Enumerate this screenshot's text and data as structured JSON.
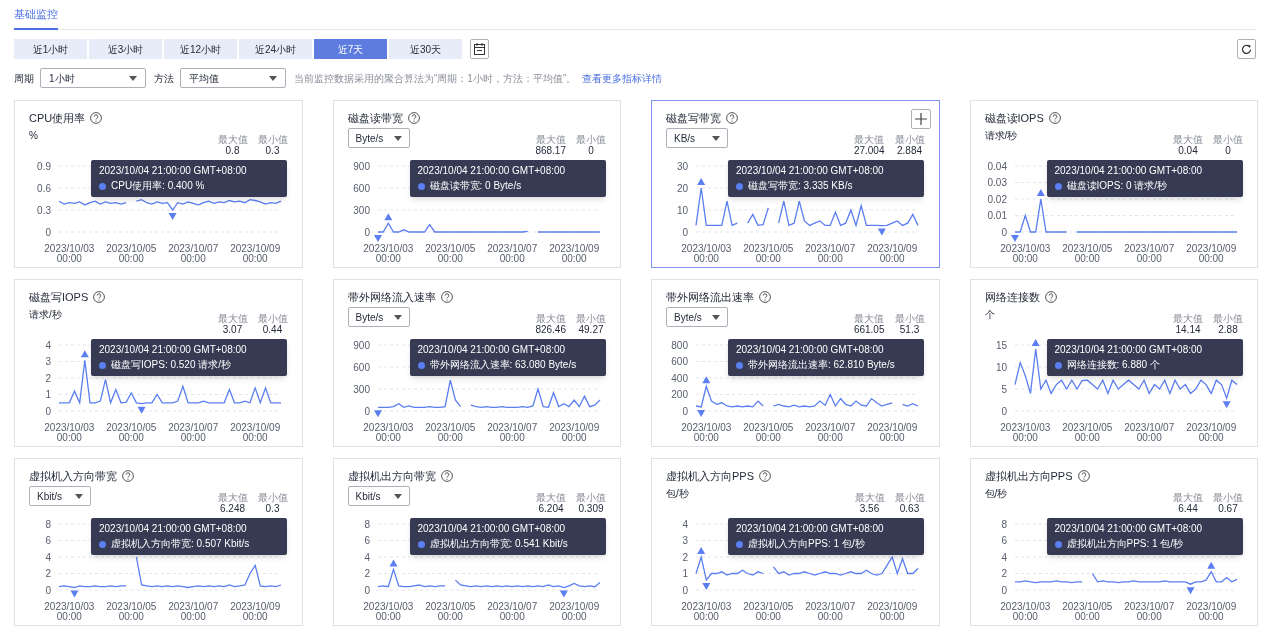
{
  "tabs": [
    {
      "label": "基础监控",
      "selected": true
    }
  ],
  "time_ranges": [
    {
      "label": "近1小时",
      "selected": false
    },
    {
      "label": "近3小时",
      "selected": false
    },
    {
      "label": "近12小时",
      "selected": false
    },
    {
      "label": "近24小时",
      "selected": false
    },
    {
      "label": "近7天",
      "selected": true
    },
    {
      "label": "近30天",
      "selected": false
    }
  ],
  "filters": {
    "period_label": "周期",
    "period": "1小时",
    "method_label": "方法",
    "method": "平均值",
    "note": "当前监控数据采用的聚合算法为“周期：1小时，方法：平均值”。",
    "link": "查看更多指标详情"
  },
  "cards": [
    {
      "title": "CPU使用率",
      "selected": false,
      "unit": {
        "kind": "label",
        "text": "%"
      },
      "stats": [
        {
          "label": "最大值",
          "value": "0.8"
        },
        {
          "label": "最小值",
          "value": "0.3"
        }
      ],
      "tooltip": {
        "time": "2023/10/04 21:00:00 GMT+08:00",
        "text": "CPU使用率: 0.400 %"
      },
      "chart_data": {
        "type": "line",
        "grid": true,
        "ylim": [
          0,
          0.9
        ],
        "yticks": [
          {
            "value": 0,
            "label": "0"
          },
          {
            "value": 0.3,
            "label": "0.3"
          },
          {
            "value": 0.6,
            "label": "0.6"
          },
          {
            "value": 0.9,
            "label": "0.9"
          }
        ],
        "categories": [
          null,
          null,
          "2023/10/03 00:00",
          null,
          null,
          null,
          null,
          null,
          null,
          null,
          null,
          null,
          null,
          null,
          "2023/10/05 00:00",
          null,
          null,
          null,
          null,
          null,
          null,
          null,
          null,
          null,
          null,
          null,
          "2023/10/07 00:00",
          null,
          null,
          null,
          null,
          null,
          null,
          null,
          null,
          null,
          null,
          null,
          "2023/10/09 00:00",
          null,
          null,
          null,
          null,
          null
        ],
        "series": [
          {
            "color": "#5b7ef0",
            "values": [
              0.42,
              0.38,
              0.4,
              0.39,
              0.41,
              0.37,
              0.4,
              0.42,
              0.38,
              0.41,
              0.39,
              0.4,
              0.38,
              0.4,
              null,
              0.42,
              0.44,
              0.4,
              0.38,
              0.41,
              0.39,
              0.4,
              0.3,
              0.4,
              0.38,
              0.41,
              0.39,
              0.37,
              0.4,
              0.42,
              0.39,
              0.41,
              0.4,
              0.43,
              0.41,
              0.42,
              0.4,
              0.44,
              0.43,
              0.41,
              0.38,
              0.4,
              0.39,
              0.42
            ]
          }
        ]
      }
    },
    {
      "title": "磁盘读带宽",
      "selected": false,
      "unit": {
        "kind": "dropdown",
        "text": "Byte/s"
      },
      "stats": [
        {
          "label": "最大值",
          "value": "868.17"
        },
        {
          "label": "最小值",
          "value": "0"
        }
      ],
      "tooltip": {
        "time": "2023/10/04 21:00:00 GMT+08:00",
        "text": "磁盘读带宽: 0 Byte/s"
      },
      "chart_data": {
        "type": "line",
        "grid": true,
        "ylim": [
          0,
          900
        ],
        "yticks": [
          {
            "value": 0,
            "label": "0"
          },
          {
            "value": 300,
            "label": "300"
          },
          {
            "value": 600,
            "label": "600"
          },
          {
            "value": 900,
            "label": "900"
          }
        ],
        "categories": [
          null,
          null,
          "2023/10/03 00:00",
          null,
          null,
          null,
          null,
          null,
          null,
          null,
          null,
          null,
          null,
          null,
          "2023/10/05 00:00",
          null,
          null,
          null,
          null,
          null,
          null,
          null,
          null,
          null,
          null,
          null,
          "2023/10/07 00:00",
          null,
          null,
          null,
          null,
          null,
          null,
          null,
          null,
          null,
          null,
          null,
          "2023/10/09 00:00",
          null,
          null,
          null,
          null,
          null
        ],
        "series": [
          {
            "color": "#5b7ef0",
            "values": [
              0,
              0,
              120,
              0,
              0,
              30,
              0,
              0,
              0,
              0,
              100,
              0,
              0,
              0,
              0,
              0,
              0,
              0,
              0,
              0,
              0,
              0,
              0,
              0,
              0,
              0,
              0,
              0,
              0,
              10,
              null,
              0,
              0,
              0,
              0,
              0,
              0,
              0,
              0,
              0,
              0,
              0,
              0,
              0
            ]
          }
        ]
      }
    },
    {
      "title": "磁盘写带宽",
      "selected": true,
      "unit": {
        "kind": "dropdown",
        "text": "KB/s"
      },
      "stats": [
        {
          "label": "最大值",
          "value": "27.004"
        },
        {
          "label": "最小值",
          "value": "2.884"
        }
      ],
      "tooltip": {
        "time": "2023/10/04 21:00:00 GMT+08:00",
        "text": "磁盘写带宽: 3.335 KB/s"
      },
      "chart_data": {
        "type": "line",
        "grid": true,
        "ylim": [
          0,
          30
        ],
        "yticks": [
          {
            "value": 0,
            "label": "0"
          },
          {
            "value": 10,
            "label": "10"
          },
          {
            "value": 20,
            "label": "20"
          },
          {
            "value": 30,
            "label": "30"
          }
        ],
        "categories": [
          null,
          null,
          "2023/10/03 00:00",
          null,
          null,
          null,
          null,
          null,
          null,
          null,
          null,
          null,
          null,
          null,
          "2023/10/05 00:00",
          null,
          null,
          null,
          null,
          null,
          null,
          null,
          null,
          null,
          null,
          null,
          "2023/10/07 00:00",
          null,
          null,
          null,
          null,
          null,
          null,
          null,
          null,
          null,
          null,
          null,
          "2023/10/09 00:00",
          null,
          null,
          null,
          null,
          null
        ],
        "series": [
          {
            "color": "#5b7ef0",
            "values": [
              3,
              20,
              3,
              3,
              3,
              3,
              14,
              3,
              4,
              null,
              4,
              8,
              3,
              3.3,
              11,
              null,
              4,
              14,
              3,
              4,
              14,
              5,
              3,
              4,
              5,
              3,
              3,
              9,
              3,
              4,
              10,
              3,
              12,
              3,
              3,
              3,
              2.9,
              3,
              4,
              5,
              3,
              4,
              8,
              3
            ]
          }
        ]
      }
    },
    {
      "title": "磁盘读IOPS",
      "selected": false,
      "unit": {
        "kind": "label",
        "text": "请求/秒"
      },
      "stats": [
        {
          "label": "最大值",
          "value": "0.04"
        },
        {
          "label": "最小值",
          "value": "0"
        }
      ],
      "tooltip": {
        "time": "2023/10/04 21:00:00 GMT+08:00",
        "text": "磁盘读IOPS: 0 请求/秒"
      },
      "chart_data": {
        "type": "line",
        "grid": true,
        "ylim": [
          0,
          0.04
        ],
        "yticks": [
          {
            "value": 0,
            "label": "0"
          },
          {
            "value": 0.01,
            "label": "0.01"
          },
          {
            "value": 0.02,
            "label": "0.02"
          },
          {
            "value": 0.03,
            "label": "0.03"
          },
          {
            "value": 0.04,
            "label": "0.04"
          }
        ],
        "categories": [
          null,
          null,
          "2023/10/03 00:00",
          null,
          null,
          null,
          null,
          null,
          null,
          null,
          null,
          null,
          null,
          null,
          "2023/10/05 00:00",
          null,
          null,
          null,
          null,
          null,
          null,
          null,
          null,
          null,
          null,
          null,
          "2023/10/07 00:00",
          null,
          null,
          null,
          null,
          null,
          null,
          null,
          null,
          null,
          null,
          null,
          "2023/10/09 00:00",
          null,
          null,
          null,
          null,
          null
        ],
        "series": [
          {
            "color": "#5b7ef0",
            "values": [
              0,
              0,
              0.01,
              0,
              0,
              0.02,
              0,
              0,
              0,
              0,
              0,
              null,
              0,
              0,
              0,
              0,
              0,
              0,
              0,
              0,
              0,
              0,
              0,
              0,
              0,
              0,
              0,
              0,
              0,
              0,
              0,
              0,
              0,
              0,
              0,
              0,
              0,
              0,
              0,
              0,
              0,
              0,
              0,
              0
            ]
          }
        ]
      }
    },
    {
      "title": "磁盘写IOPS",
      "selected": false,
      "unit": {
        "kind": "label",
        "text": "请求/秒"
      },
      "stats": [
        {
          "label": "最大值",
          "value": "3.07"
        },
        {
          "label": "最小值",
          "value": "0.44"
        }
      ],
      "tooltip": {
        "time": "2023/10/04 21:00:00 GMT+08:00",
        "text": "磁盘写IOPS: 0.520 请求/秒"
      },
      "chart_data": {
        "type": "line",
        "grid": true,
        "ylim": [
          0,
          4
        ],
        "yticks": [
          {
            "value": 0,
            "label": "0"
          },
          {
            "value": 1,
            "label": "1"
          },
          {
            "value": 2,
            "label": "2"
          },
          {
            "value": 3,
            "label": "3"
          },
          {
            "value": 4,
            "label": "4"
          }
        ],
        "categories": [
          null,
          null,
          "2023/10/03 00:00",
          null,
          null,
          null,
          null,
          null,
          null,
          null,
          null,
          null,
          null,
          null,
          "2023/10/05 00:00",
          null,
          null,
          null,
          null,
          null,
          null,
          null,
          null,
          null,
          null,
          null,
          "2023/10/07 00:00",
          null,
          null,
          null,
          null,
          null,
          null,
          null,
          null,
          null,
          null,
          null,
          "2023/10/09 00:00",
          null,
          null,
          null,
          null,
          null
        ],
        "series": [
          {
            "color": "#5b7ef0",
            "values": [
              0.5,
              0.5,
              0.5,
              1.2,
              0.5,
              3.07,
              0.5,
              0.5,
              0.6,
              1.9,
              0.5,
              1.3,
              0.5,
              0.52,
              1.1,
              0.5,
              0.44,
              0.5,
              0.5,
              1.0,
              0.5,
              0.5,
              0.5,
              0.6,
              1.5,
              0.5,
              0.5,
              0.5,
              0.6,
              0.5,
              0.5,
              0.5,
              0.5,
              1.3,
              0.5,
              0.5,
              0.6,
              0.5,
              1.4,
              0.5,
              1.4,
              0.5,
              0.5,
              0.5
            ]
          }
        ]
      }
    },
    {
      "title": "带外网络流入速率",
      "selected": false,
      "unit": {
        "kind": "dropdown",
        "text": "Byte/s"
      },
      "stats": [
        {
          "label": "最大值",
          "value": "826.46"
        },
        {
          "label": "最小值",
          "value": "49.27"
        }
      ],
      "tooltip": {
        "time": "2023/10/04 21:00:00 GMT+08:00",
        "text": "带外网络流入速率: 63.080 Byte/s"
      },
      "chart_data": {
        "type": "line",
        "grid": true,
        "ylim": [
          0,
          900
        ],
        "yticks": [
          {
            "value": 0,
            "label": "0"
          },
          {
            "value": 300,
            "label": "300"
          },
          {
            "value": 600,
            "label": "600"
          },
          {
            "value": 900,
            "label": "900"
          }
        ],
        "categories": [
          null,
          null,
          "2023/10/03 00:00",
          null,
          null,
          null,
          null,
          null,
          null,
          null,
          null,
          null,
          null,
          null,
          "2023/10/05 00:00",
          null,
          null,
          null,
          null,
          null,
          null,
          null,
          null,
          null,
          null,
          null,
          "2023/10/07 00:00",
          null,
          null,
          null,
          null,
          null,
          null,
          null,
          null,
          null,
          null,
          null,
          "2023/10/09 00:00",
          null,
          null,
          null,
          null,
          null
        ],
        "series": [
          {
            "color": "#5b7ef0",
            "values": [
              50,
              50,
              50,
              60,
              100,
              50,
              70,
              50,
              50,
              50,
              60,
              50,
              50,
              60,
              420,
              150,
              60,
              null,
              80,
              60,
              50,
              60,
              50,
              50,
              60,
              50,
              50,
              50,
              60,
              50,
              70,
              300,
              60,
              50,
              250,
              60,
              100,
              60,
              150,
              60,
              200,
              60,
              80,
              150
            ]
          }
        ]
      }
    },
    {
      "title": "带外网络流出速率",
      "selected": false,
      "unit": {
        "kind": "dropdown",
        "text": "Byte/s"
      },
      "stats": [
        {
          "label": "最大值",
          "value": "661.05"
        },
        {
          "label": "最小值",
          "value": "51.3"
        }
      ],
      "tooltip": {
        "time": "2023/10/04 21:00:00 GMT+08:00",
        "text": "带外网络流出速率: 62.810 Byte/s"
      },
      "chart_data": {
        "type": "line",
        "grid": true,
        "ylim": [
          0,
          800
        ],
        "yticks": [
          {
            "value": 0,
            "label": "0"
          },
          {
            "value": 200,
            "label": "200"
          },
          {
            "value": 400,
            "label": "400"
          },
          {
            "value": 600,
            "label": "600"
          },
          {
            "value": 800,
            "label": "800"
          }
        ],
        "categories": [
          null,
          null,
          "2023/10/03 00:00",
          null,
          null,
          null,
          null,
          null,
          null,
          null,
          null,
          null,
          null,
          null,
          "2023/10/05 00:00",
          null,
          null,
          null,
          null,
          null,
          null,
          null,
          null,
          null,
          null,
          null,
          "2023/10/07 00:00",
          null,
          null,
          null,
          null,
          null,
          null,
          null,
          null,
          null,
          null,
          null,
          "2023/10/09 00:00",
          null,
          null,
          null,
          null,
          null
        ],
        "series": [
          {
            "color": "#5b7ef0",
            "values": [
              60,
              50,
              300,
              120,
              80,
              100,
              60,
              50,
              60,
              50,
              60,
              50,
              120,
              60,
              null,
              60,
              80,
              60,
              50,
              70,
              50,
              60,
              50,
              60,
              120,
              70,
              200,
              60,
              150,
              80,
              60,
              120,
              70,
              60,
              150,
              100,
              60,
              80,
              100,
              null,
              80,
              60,
              90,
              60
            ]
          }
        ]
      }
    },
    {
      "title": "网络连接数",
      "selected": false,
      "unit": {
        "kind": "label",
        "text": "个"
      },
      "stats": [
        {
          "label": "最大值",
          "value": "14.14"
        },
        {
          "label": "最小值",
          "value": "2.88"
        }
      ],
      "tooltip": {
        "time": "2023/10/04 21:00:00 GMT+08:00",
        "text": "网络连接数: 6.880 个"
      },
      "chart_data": {
        "type": "line",
        "grid": true,
        "ylim": [
          0,
          15
        ],
        "yticks": [
          {
            "value": 0,
            "label": "0"
          },
          {
            "value": 5,
            "label": "5"
          },
          {
            "value": 10,
            "label": "10"
          },
          {
            "value": 15,
            "label": "15"
          }
        ],
        "categories": [
          null,
          null,
          "2023/10/03 00:00",
          null,
          null,
          null,
          null,
          null,
          null,
          null,
          null,
          null,
          null,
          null,
          "2023/10/05 00:00",
          null,
          null,
          null,
          null,
          null,
          null,
          null,
          null,
          null,
          null,
          null,
          "2023/10/07 00:00",
          null,
          null,
          null,
          null,
          null,
          null,
          null,
          null,
          null,
          null,
          null,
          "2023/10/09 00:00",
          null,
          null,
          null,
          null,
          null
        ],
        "series": [
          {
            "color": "#5b7ef0",
            "values": [
              6,
              11,
              8,
              4,
              14.1,
              5,
              7,
              4,
              6,
              7,
              5,
              7,
              5,
              6.9,
              7,
              6,
              5,
              7,
              4,
              7,
              5,
              6,
              7,
              6,
              5,
              7,
              4,
              6,
              5,
              7,
              4,
              7,
              5,
              6,
              4,
              5,
              7,
              6,
              4,
              7,
              6,
              2.9,
              7,
              6
            ]
          }
        ]
      }
    },
    {
      "title": "虚拟机入方向带宽",
      "selected": false,
      "unit": {
        "kind": "dropdown",
        "text": "Kbit/s"
      },
      "stats": [
        {
          "label": "最大值",
          "value": "6.248"
        },
        {
          "label": "最小值",
          "value": "0.3"
        }
      ],
      "tooltip": {
        "time": "2023/10/04 21:00:00 GMT+08:00",
        "text": "虚拟机入方向带宽: 0.507 Kbit/s"
      },
      "chart_data": {
        "type": "line",
        "grid": true,
        "ylim": [
          0,
          8
        ],
        "yticks": [
          {
            "value": 0,
            "label": "0"
          },
          {
            "value": 2,
            "label": "2"
          },
          {
            "value": 4,
            "label": "4"
          },
          {
            "value": 6,
            "label": "6"
          },
          {
            "value": 8,
            "label": "8"
          }
        ],
        "categories": [
          null,
          null,
          "2023/10/03 00:00",
          null,
          null,
          null,
          null,
          null,
          null,
          null,
          null,
          null,
          null,
          null,
          "2023/10/05 00:00",
          null,
          null,
          null,
          null,
          null,
          null,
          null,
          null,
          null,
          null,
          null,
          "2023/10/07 00:00",
          null,
          null,
          null,
          null,
          null,
          null,
          null,
          null,
          null,
          null,
          null,
          "2023/10/09 00:00",
          null,
          null,
          null,
          null,
          null
        ],
        "series": [
          {
            "color": "#5b7ef0",
            "values": [
              0.4,
              0.5,
              0.4,
              0.3,
              0.5,
              0.4,
              0.4,
              0.5,
              0.4,
              0.4,
              0.5,
              0.4,
              0.5,
              0.5,
              null,
              4.0,
              0.6,
              0.5,
              0.4,
              0.5,
              0.4,
              0.5,
              0.4,
              0.5,
              0.4,
              0.3,
              0.4,
              0.5,
              0.4,
              0.5,
              0.4,
              0.5,
              0.4,
              0.6,
              0.4,
              0.5,
              0.6,
              2.0,
              3.0,
              0.5,
              0.4,
              0.5,
              0.4,
              0.6
            ]
          }
        ]
      }
    },
    {
      "title": "虚拟机出方向带宽",
      "selected": false,
      "unit": {
        "kind": "dropdown",
        "text": "Kbit/s"
      },
      "stats": [
        {
          "label": "最大值",
          "value": "6.204"
        },
        {
          "label": "最小值",
          "value": "0.309"
        }
      ],
      "tooltip": {
        "time": "2023/10/04 21:00:00 GMT+08:00",
        "text": "虚拟机出方向带宽: 0.541 Kbit/s"
      },
      "chart_data": {
        "type": "line",
        "grid": true,
        "ylim": [
          0,
          8
        ],
        "yticks": [
          {
            "value": 0,
            "label": "0"
          },
          {
            "value": 2,
            "label": "2"
          },
          {
            "value": 4,
            "label": "4"
          },
          {
            "value": 6,
            "label": "6"
          },
          {
            "value": 8,
            "label": "8"
          }
        ],
        "categories": [
          null,
          null,
          "2023/10/03 00:00",
          null,
          null,
          null,
          null,
          null,
          null,
          null,
          null,
          null,
          null,
          null,
          "2023/10/05 00:00",
          null,
          null,
          null,
          null,
          null,
          null,
          null,
          null,
          null,
          null,
          null,
          "2023/10/07 00:00",
          null,
          null,
          null,
          null,
          null,
          null,
          null,
          null,
          null,
          null,
          null,
          "2023/10/09 00:00",
          null,
          null,
          null,
          null,
          null
        ],
        "series": [
          {
            "color": "#5b7ef0",
            "values": [
              0.4,
              0.5,
              0.4,
              2.5,
              0.5,
              0.4,
              0.4,
              0.5,
              0.6,
              0.4,
              0.5,
              0.4,
              0.5,
              0.5,
              null,
              1.2,
              0.6,
              0.5,
              0.4,
              0.5,
              0.4,
              0.5,
              0.4,
              0.5,
              0.4,
              0.5,
              0.4,
              0.5,
              0.4,
              0.5,
              0.4,
              0.5,
              0.4,
              0.6,
              0.4,
              0.5,
              0.3,
              0.5,
              0.8,
              0.5,
              0.4,
              0.5,
              0.4,
              0.9
            ]
          }
        ]
      }
    },
    {
      "title": "虚拟机入方向PPS",
      "selected": false,
      "unit": {
        "kind": "label",
        "text": "包/秒"
      },
      "stats": [
        {
          "label": "最大值",
          "value": "3.56"
        },
        {
          "label": "最小值",
          "value": "0.63"
        }
      ],
      "tooltip": {
        "time": "2023/10/04 21:00:00 GMT+08:00",
        "text": "虚拟机入方向PPS: 1 包/秒"
      },
      "chart_data": {
        "type": "line",
        "grid": true,
        "ylim": [
          0,
          4
        ],
        "yticks": [
          {
            "value": 0,
            "label": "0"
          },
          {
            "value": 1,
            "label": "1"
          },
          {
            "value": 2,
            "label": "2"
          },
          {
            "value": 3,
            "label": "3"
          },
          {
            "value": 4,
            "label": "4"
          }
        ],
        "categories": [
          null,
          null,
          "2023/10/03 00:00",
          null,
          null,
          null,
          null,
          null,
          null,
          null,
          null,
          null,
          null,
          null,
          "2023/10/05 00:00",
          null,
          null,
          null,
          null,
          null,
          null,
          null,
          null,
          null,
          null,
          null,
          "2023/10/07 00:00",
          null,
          null,
          null,
          null,
          null,
          null,
          null,
          null,
          null,
          null,
          null,
          "2023/10/09 00:00",
          null,
          null,
          null,
          null,
          null
        ],
        "series": [
          {
            "color": "#5b7ef0",
            "values": [
              1,
              2,
              0.6,
              1,
              1,
              1.1,
              0.9,
              1,
              1,
              1.2,
              1,
              0.9,
              1.1,
              1,
              null,
              1.4,
              1,
              1.1,
              0.9,
              1,
              1,
              1.1,
              1,
              0.9,
              1,
              1.1,
              1,
              1,
              0.9,
              1,
              1.1,
              1,
              1,
              1.2,
              1,
              0.9,
              1,
              1.5,
              2,
              1,
              1.9,
              1,
              1,
              1.3
            ]
          }
        ]
      }
    },
    {
      "title": "虚拟机出方向PPS",
      "selected": false,
      "unit": {
        "kind": "label",
        "text": "包/秒"
      },
      "stats": [
        {
          "label": "最大值",
          "value": "6.44"
        },
        {
          "label": "最小值",
          "value": "0.67"
        }
      ],
      "tooltip": {
        "time": "2023/10/04 21:00:00 GMT+08:00",
        "text": "虚拟机出方向PPS: 1 包/秒"
      },
      "chart_data": {
        "type": "line",
        "grid": true,
        "ylim": [
          0,
          8
        ],
        "yticks": [
          {
            "value": 0,
            "label": "0"
          },
          {
            "value": 2,
            "label": "2"
          },
          {
            "value": 4,
            "label": "4"
          },
          {
            "value": 6,
            "label": "6"
          },
          {
            "value": 8,
            "label": "8"
          }
        ],
        "categories": [
          null,
          null,
          "2023/10/03 00:00",
          null,
          null,
          null,
          null,
          null,
          null,
          null,
          null,
          null,
          null,
          null,
          "2023/10/05 00:00",
          null,
          null,
          null,
          null,
          null,
          null,
          null,
          null,
          null,
          null,
          null,
          "2023/10/07 00:00",
          null,
          null,
          null,
          null,
          null,
          null,
          null,
          null,
          null,
          null,
          null,
          "2023/10/09 00:00",
          null,
          null,
          null,
          null,
          null
        ],
        "series": [
          {
            "color": "#5b7ef0",
            "values": [
              1,
              1,
              1.1,
              1,
              0.9,
              1,
              1,
              1,
              1.1,
              1,
              1,
              0.9,
              1,
              1,
              null,
              2,
              1,
              1.1,
              1,
              1,
              0.9,
              1,
              1,
              1.1,
              1,
              1,
              1,
              1,
              1,
              1.1,
              1,
              1,
              1,
              1,
              0.7,
              1,
              1,
              1.2,
              2.2,
              1,
              1,
              1.5,
              1,
              1.3
            ]
          }
        ]
      }
    }
  ]
}
